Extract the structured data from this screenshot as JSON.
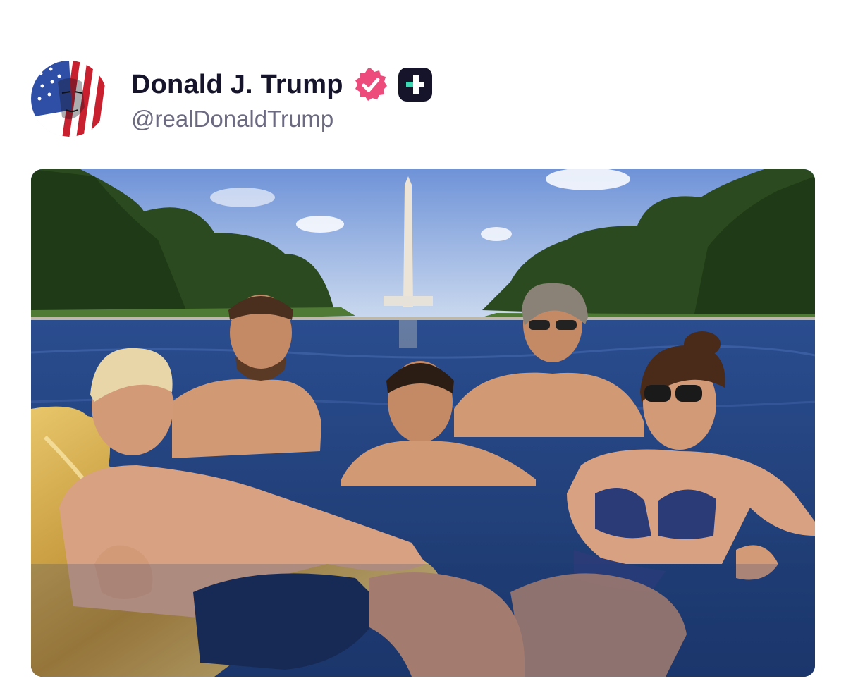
{
  "post": {
    "author": {
      "display_name": "Donald J. Trump",
      "handle": "@realDonaldTrump",
      "avatar_icon": "flag-portrait-avatar",
      "verified_icon": "verified-badge-icon",
      "plus_icon": "plus-badge-icon"
    },
    "media": {
      "type": "photo"
    },
    "colors": {
      "verified": "#ee4b7d",
      "plus_badge_bg": "#15142b",
      "plus_badge_accent": "#3ed6b3",
      "name_text": "#15142b",
      "handle_text": "#6b6a80"
    }
  }
}
